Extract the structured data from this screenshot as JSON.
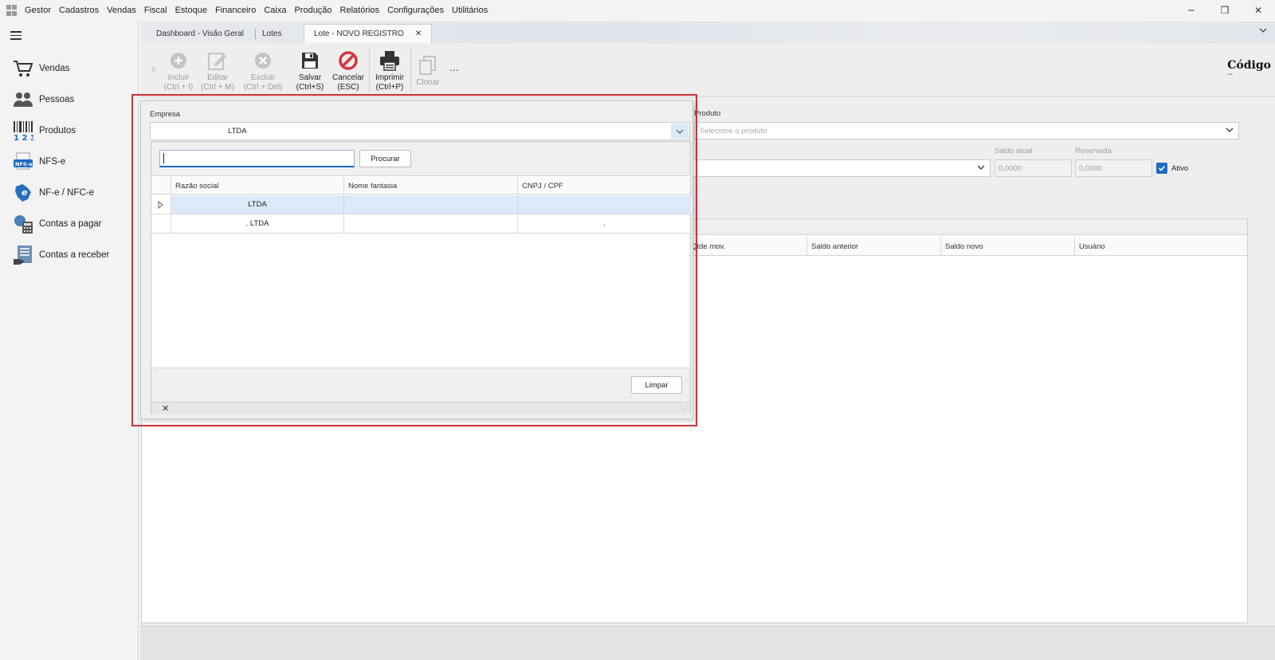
{
  "menu": [
    "Gestor",
    "Cadastros",
    "Vendas",
    "Fiscal",
    "Estoque",
    "Financeiro",
    "Caixa",
    "Produção",
    "Relatórios",
    "Configurações",
    "Utilitários"
  ],
  "window_controls": {
    "minimize": "─",
    "restore": "❐",
    "close": "✕"
  },
  "sidebar": {
    "items": [
      {
        "label": "Vendas",
        "icon": "cart-icon"
      },
      {
        "label": "Pessoas",
        "icon": "people-icon"
      },
      {
        "label": "Produtos",
        "icon": "barcode-icon"
      },
      {
        "label": "NFS-e",
        "icon": "nfse-icon"
      },
      {
        "label": "NF-e / NFC-e",
        "icon": "nfe-icon"
      },
      {
        "label": "Contas a pagar",
        "icon": "calculator-icon"
      },
      {
        "label": "Contas a receber",
        "icon": "receivables-icon"
      }
    ]
  },
  "tabs": [
    {
      "label": "Dashboard - Visão Geral"
    },
    {
      "label": "Lotes"
    },
    {
      "label": "Lote - NOVO REGISTRO",
      "closable": true,
      "close": "✕"
    }
  ],
  "toolbar": {
    "incluir": {
      "label": "Incluir",
      "shortcut": "(Ctrl + I)"
    },
    "editar": {
      "label": "Editar",
      "shortcut": "(Ctrl + M)"
    },
    "excluir": {
      "label": "Excluir",
      "shortcut": "(Ctrl + Del)"
    },
    "salvar": {
      "label": "Salvar",
      "shortcut": "(Ctrl+S)"
    },
    "cancelar": {
      "label": "Cancelar",
      "shortcut": "(ESC)"
    },
    "imprimir": {
      "label": "Imprimir",
      "shortcut": "(Ctrl+P)"
    },
    "clonar": {
      "label": "Clonar"
    },
    "more": "..."
  },
  "codigo": {
    "label": "Código",
    "value": "--"
  },
  "form": {
    "produto_label": "Produto",
    "produto_placeholder": "Selecione o produto",
    "saldo_atual_label": "Saldo atual",
    "saldo_atual_value": "0,0000",
    "reservada_label": "Reservada",
    "reservada_value": "0,0000",
    "ativo_label": "Ativo",
    "ativo_checked": true
  },
  "grid": {
    "columns": [
      "Qtde mov.",
      "Saldo anterior",
      "Saldo novo",
      "Usuário"
    ]
  },
  "popup": {
    "empresa_label": "Empresa",
    "empresa_value": "LTDA",
    "search_value": "",
    "procurar_label": "Procurar",
    "columns": [
      "Razão social",
      "Nome fantasia",
      "CNPJ / CPF"
    ],
    "rows": [
      {
        "razao": "LTDA",
        "fantasia": "",
        "cnpj": "",
        "selected": true
      },
      {
        "razao": ". LTDA",
        "fantasia": "",
        "cnpj": ".",
        "selected": false
      }
    ],
    "limpar_label": "Limpar",
    "close": "✕",
    "resize": "⋰"
  },
  "colors": {
    "accent": "#1e6bc4",
    "highlight_border": "#c9323b",
    "cancel_red": "#d9343c",
    "selected_row": "#dbe9f8"
  }
}
